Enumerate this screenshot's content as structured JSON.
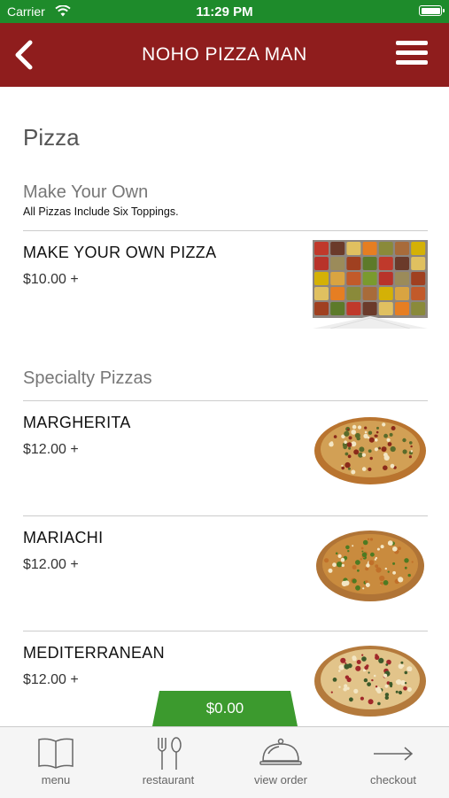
{
  "status_bar": {
    "carrier": "Carrier",
    "time": "11:29 PM"
  },
  "nav": {
    "title": "NOHO PIZZA MAN"
  },
  "page": {
    "title": "Pizza"
  },
  "sections": [
    {
      "title": "Make Your Own",
      "subtitle": "All Pizzas Include Six Toppings.",
      "items": [
        {
          "name": "MAKE YOUR OWN PIZZA",
          "price": "$10.00 +"
        }
      ]
    },
    {
      "title": "Specialty Pizzas",
      "items": [
        {
          "name": "MARGHERITA",
          "price": "$12.00 +"
        },
        {
          "name": "MARIACHI",
          "price": "$12.00 +"
        },
        {
          "name": "MEDITERRANEAN",
          "price": "$12.00 +"
        }
      ]
    }
  ],
  "order_total": "$0.00",
  "tabs": [
    {
      "label": "menu",
      "icon": "book-icon"
    },
    {
      "label": "restaurant",
      "icon": "fork-knife-icon"
    },
    {
      "label": "view order",
      "icon": "cloche-icon"
    },
    {
      "label": "checkout",
      "icon": "arrow-right-icon"
    }
  ],
  "colors": {
    "status_bar": "#1e8b2b",
    "nav_bar": "#8f1d1d",
    "total_tab": "#3c9a2e"
  }
}
